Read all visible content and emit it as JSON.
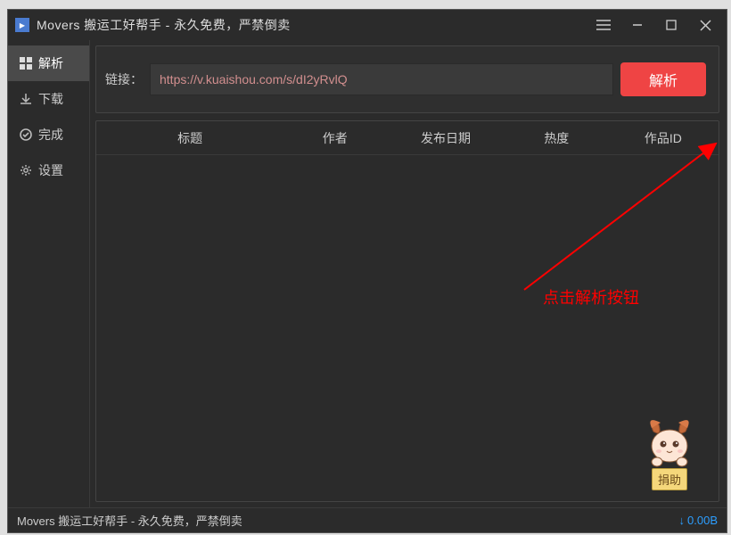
{
  "titlebar": {
    "title": "Movers 搬运工好帮手 - 永久免费，严禁倒卖"
  },
  "sidebar": {
    "items": [
      {
        "label": "解析",
        "active": true,
        "icon": "grid"
      },
      {
        "label": "下载",
        "active": false,
        "icon": "download"
      },
      {
        "label": "完成",
        "active": false,
        "icon": "check"
      },
      {
        "label": "设置",
        "active": false,
        "icon": "gear"
      }
    ]
  },
  "link_panel": {
    "label": "链接：",
    "value": "https://v.kuaishou.com/s/dI2yRvlQ",
    "parse_btn": "解析"
  },
  "table": {
    "headers": [
      "标题",
      "作者",
      "发布日期",
      "热度",
      "作品ID"
    ]
  },
  "annotation": {
    "text": "点击解析按钮"
  },
  "mascot": {
    "sign": "捐助"
  },
  "statusbar": {
    "text": "Movers 搬运工好帮手 - 永久免费，严禁倒卖",
    "speed": "0.00B"
  }
}
